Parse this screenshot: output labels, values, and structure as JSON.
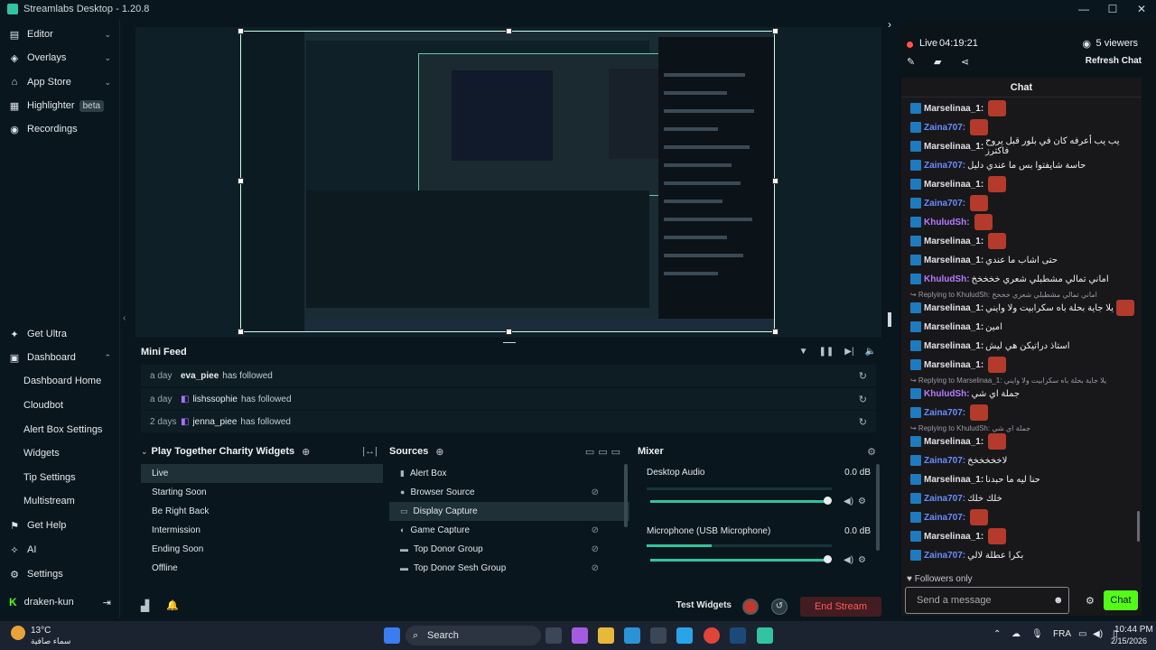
{
  "window": {
    "title": "Streamlabs Desktop - 1.20.8"
  },
  "sidebar": {
    "items": [
      {
        "label": "Editor",
        "icon": "editor-icon"
      },
      {
        "label": "Overlays",
        "icon": "overlays-icon"
      },
      {
        "label": "App Store",
        "icon": "store-icon"
      },
      {
        "label": "Highlighter",
        "badge": "beta",
        "icon": "highlighter-icon"
      },
      {
        "label": "Recordings",
        "icon": "recordings-icon"
      }
    ],
    "bottom_items": [
      {
        "label": "Get Ultra"
      },
      {
        "label": "Dashboard"
      }
    ],
    "dashboard_sub": [
      "Dashboard Home",
      "Cloudbot",
      "Alert Box Settings",
      "Widgets",
      "Tip Settings",
      "Multistream"
    ],
    "extra_items": [
      {
        "label": "Get Help"
      },
      {
        "label": "AI"
      },
      {
        "label": "Settings"
      }
    ],
    "user": "draken-kun"
  },
  "minifeed": {
    "title": "Mini Feed",
    "events": [
      {
        "time": "a day",
        "name": "eva_piee",
        "action": "has followed"
      },
      {
        "time": "a day",
        "name": "lishssophie",
        "action": "has followed"
      },
      {
        "time": "2 days",
        "name": "jenna_piee",
        "action": "has followed"
      }
    ]
  },
  "scenes": {
    "title": "Play Together Charity Widgets",
    "items": [
      "Live",
      "Starting Soon",
      "Be Right Back",
      "Intermission",
      "Ending Soon",
      "Offline"
    ],
    "selected": "Live"
  },
  "sources": {
    "title": "Sources",
    "items": [
      "Alert Box",
      "Browser Source",
      "Display Capture",
      "Game Capture",
      "Top Donor Group",
      "Top Donor Sesh Group"
    ],
    "selected": "Display Capture"
  },
  "mixer": {
    "title": "Mixer",
    "channels": [
      {
        "name": "Desktop Audio",
        "db": "0.0 dB",
        "level": 0.0,
        "volume": 1.0
      },
      {
        "name": "Microphone (USB Microphone)",
        "db": "0.0 dB",
        "level": 0.35,
        "volume": 1.0
      }
    ]
  },
  "footer": {
    "test_widgets": "Test Widgets",
    "end_stream": "End Stream"
  },
  "stream": {
    "live_label": "Live",
    "duration": "04:19:21",
    "viewers": "5 viewers",
    "refresh_chat": "Refresh Chat"
  },
  "chat": {
    "title": "Chat",
    "messages": [
      {
        "user": "Marselinaa_1:",
        "color": "#e0e0e6",
        "text": "",
        "emote": true
      },
      {
        "user": "Zaina707:",
        "color": "#6a8cff",
        "text": "",
        "emote": true
      },
      {
        "user": "Marselinaa_1:",
        "color": "#e0e0e6",
        "text": "يب يب أعرفه كان في بلور قبل يروح فاكترز",
        "emote": false
      },
      {
        "user": "Zaina707:",
        "color": "#6a8cff",
        "text": "حاسة شايفتوا بس ما عندي دليل",
        "emote": false
      },
      {
        "user": "Marselinaa_1:",
        "color": "#e0e0e6",
        "text": "",
        "emote": true
      },
      {
        "user": "Zaina707:",
        "color": "#6a8cff",
        "text": "",
        "emote": true
      },
      {
        "user": "KhuludSh:",
        "color": "#b57bff",
        "text": "",
        "emote": true
      },
      {
        "user": "Marselinaa_1:",
        "color": "#e0e0e6",
        "text": "",
        "emote": true
      },
      {
        "user": "Marselinaa_1:",
        "color": "#e0e0e6",
        "text": "حتى اشاب ما عندي",
        "emote": false
      },
      {
        "user": "KhuludSh:",
        "color": "#b57bff",
        "text": "اماني تمالي مشطبلي شعري خخخخخ",
        "emote": false
      },
      {
        "user": "Marselinaa_1:",
        "color": "#e0e0e6",
        "text": "يلا جاية بحلة باه سكرابيت ولا وايني",
        "emote": true,
        "reply": "Replying to KhuludSh: اماني تمالي مشطبلي شعري خخخخ"
      },
      {
        "user": "Marselinaa_1:",
        "color": "#e0e0e6",
        "text": "امين",
        "emote": false
      },
      {
        "user": "Marselinaa_1:",
        "color": "#e0e0e6",
        "text": "استاذ دراتيكن هي ليش",
        "emote": false
      },
      {
        "user": "Marselinaa_1:",
        "color": "#e0e0e6",
        "text": "",
        "emote": true
      },
      {
        "user": "KhuludSh:",
        "color": "#b57bff",
        "text": "جملة اي شي",
        "emote": false,
        "reply": "Replying to Marselinaa_1: يلا جاية بحلة باه سكرابيت ولا وايني"
      },
      {
        "user": "Zaina707:",
        "color": "#6a8cff",
        "text": "",
        "emote": true
      },
      {
        "user": "Marselinaa_1:",
        "color": "#e0e0e6",
        "text": "",
        "emote": true,
        "reply": "Replying to KhuludSh: جملة اي شي"
      },
      {
        "user": "Zaina707:",
        "color": "#6a8cff",
        "text": "لاخخخخخخ",
        "emote": false
      },
      {
        "user": "Marselinaa_1:",
        "color": "#e0e0e6",
        "text": "حنا ليه ما حبدنا",
        "emote": false
      },
      {
        "user": "Zaina707:",
        "color": "#6a8cff",
        "text": "خلك خلك",
        "emote": false
      },
      {
        "user": "Zaina707:",
        "color": "#6a8cff",
        "text": "",
        "emote": true
      },
      {
        "user": "Marselinaa_1:",
        "color": "#e0e0e6",
        "text": "",
        "emote": true
      },
      {
        "user": "Zaina707:",
        "color": "#6a8cff",
        "text": "بكرا عطلة لالي",
        "emote": false
      }
    ],
    "followers_only": "Followers only",
    "placeholder": "Send a message",
    "send_label": "Chat"
  },
  "taskbar": {
    "weather_temp": "13°C",
    "weather_desc": "سماء صافية",
    "search": "Search",
    "lang": "FRA",
    "time": "10:44 PM",
    "date": "2/15/2026"
  },
  "colors": {
    "accent": "#31c3a2",
    "kick_green": "#53fc18",
    "live_red": "#ff5252"
  }
}
